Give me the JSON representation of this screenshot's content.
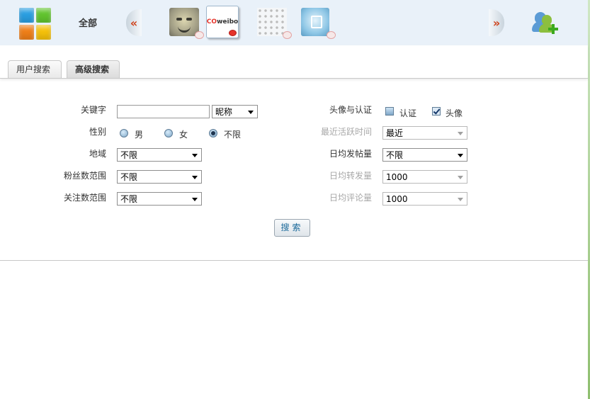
{
  "topbar": {
    "all_label": "全部",
    "prev_arrow": "«",
    "next_arrow": "»",
    "weibo_text_prefix": "CO",
    "weibo_text": "weibo"
  },
  "tabs": [
    {
      "label": "用户搜索",
      "active": false
    },
    {
      "label": "高级搜索",
      "active": true
    }
  ],
  "form": {
    "keyword": {
      "label": "关键字",
      "value": "",
      "type_select": "昵称"
    },
    "gender": {
      "label": "性别",
      "options": [
        "男",
        "女",
        "不限"
      ],
      "selected": "不限"
    },
    "region": {
      "label": "地域",
      "value": "不限"
    },
    "followers_range": {
      "label": "粉丝数范围",
      "value": "不限"
    },
    "following_range": {
      "label": "关注数范围",
      "value": "不限"
    },
    "avatar_verify": {
      "label": "头像与认证",
      "verified": {
        "label": "认证",
        "checked": false
      },
      "avatar": {
        "label": "头像",
        "checked": true
      }
    },
    "last_active": {
      "label": "最近活跃时间",
      "value": "最近"
    },
    "daily_posts": {
      "label": "日均发帖量",
      "value": "不限"
    },
    "daily_reposts": {
      "label": "日均转发量",
      "value": "1000"
    },
    "daily_comments": {
      "label": "日均评论量",
      "value": "1000"
    },
    "search_button": "搜索"
  }
}
